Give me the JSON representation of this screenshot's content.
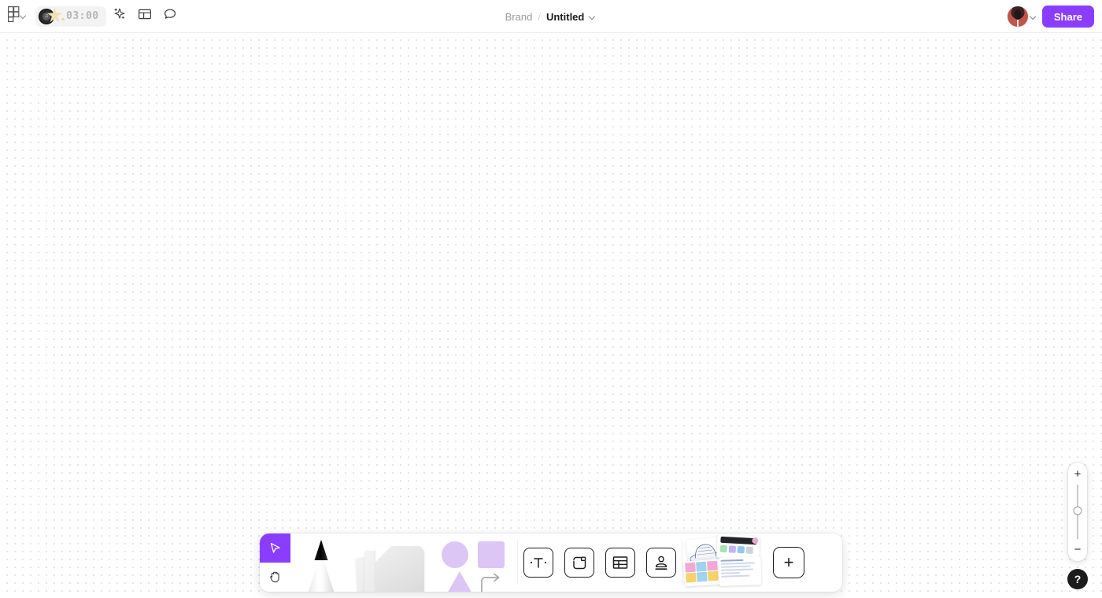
{
  "header": {
    "app_logo_icon": "figma-logo-icon",
    "logo_chevron_icon": "chevron-down-icon",
    "timer": {
      "value": "03:00",
      "record_icon": "vinyl-record-icon",
      "star_icon": "star-icon"
    },
    "actions": [
      {
        "name": "ai-sparkle-button",
        "icon": "sparkle-icon"
      },
      {
        "name": "panel-layout-button",
        "icon": "layout-panel-icon"
      },
      {
        "name": "comment-button",
        "icon": "comment-bubble-icon"
      }
    ],
    "breadcrumb": {
      "project": "Brand",
      "separator": "/",
      "title": "Untitled",
      "chevron_icon": "chevron-down-icon"
    },
    "avatar_chevron_icon": "chevron-down-icon",
    "share_label": "Share",
    "share_color": "#8b3dff"
  },
  "canvas": {
    "background": "#ffffff",
    "dot_color": "#dcdcdc"
  },
  "toolbar": {
    "tools": [
      {
        "name": "select-tool",
        "icon": "cursor-arrow-icon",
        "selected": true
      },
      {
        "name": "hand-tool",
        "icon": "hand-icon",
        "selected": false
      },
      {
        "name": "pencil-tool",
        "icon": "pencil-icon",
        "selected": false
      },
      {
        "name": "sticky-note-tool",
        "icon": "sticky-notes-icon",
        "selected": false
      },
      {
        "name": "shapes-tool",
        "icon": "shapes-icon",
        "selected": false
      },
      {
        "name": "text-tool",
        "icon": "text-t-icon",
        "selected": false
      },
      {
        "name": "frame-tool",
        "icon": "frame-icon",
        "selected": false
      },
      {
        "name": "table-tool",
        "icon": "table-icon",
        "selected": false
      },
      {
        "name": "stamp-tool",
        "icon": "stamp-icon",
        "selected": false
      },
      {
        "name": "templates-tool",
        "icon": "templates-cluster-icon",
        "selected": false
      },
      {
        "name": "add-more-tool",
        "icon": "plus-icon",
        "selected": false
      }
    ],
    "shape_color": "#dcc6f5",
    "selected_color": "#8b3dff",
    "plus_label": "+"
  },
  "zoom_control": {
    "zoom_in_label": "+",
    "zoom_out_label": "−",
    "slider_position_percent": 48
  },
  "help": {
    "label": "?"
  }
}
